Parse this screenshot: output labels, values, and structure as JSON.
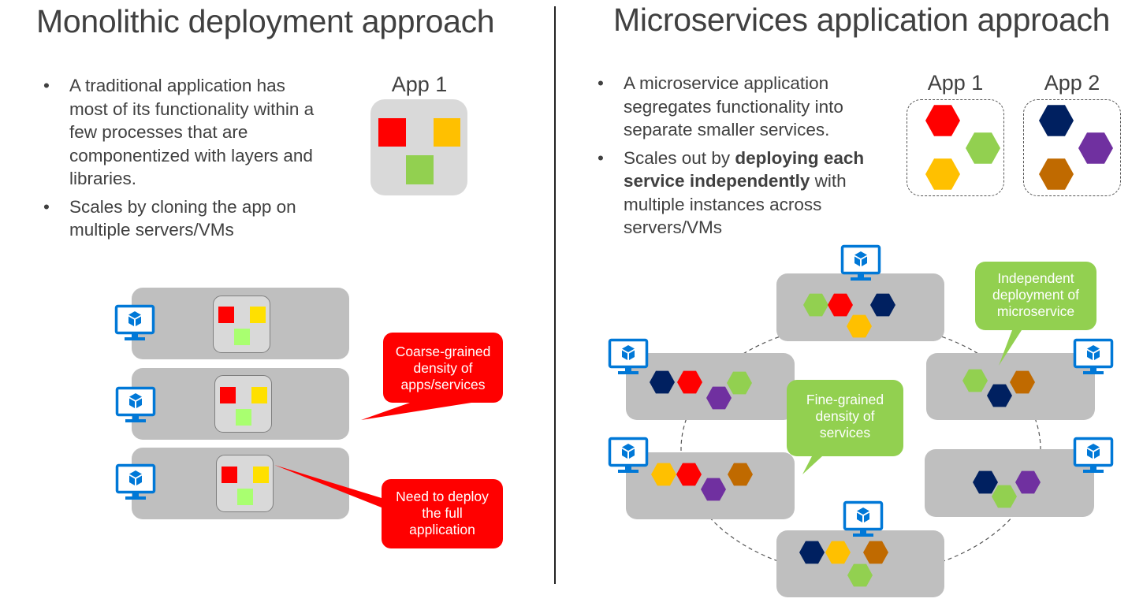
{
  "left": {
    "title": "Monolithic deployment approach",
    "bullets": [
      {
        "lines": [
          "A traditional application has",
          "most of its functionality within a",
          "few processes that are",
          "componentized with layers and",
          "libraries."
        ]
      },
      {
        "lines": [
          "Scales by cloning the app on",
          "multiple servers/VMs"
        ]
      }
    ],
    "app_label": "App 1",
    "callouts": [
      {
        "lines": [
          "Coarse-grained",
          "density of",
          "apps/services"
        ],
        "color": "#ff0000"
      },
      {
        "lines": [
          "Need to deploy",
          "the full",
          "application"
        ],
        "color": "#ff0000"
      }
    ]
  },
  "right": {
    "title": "Microservices application approach",
    "bullets": [
      {
        "lines": [
          "A microservice application",
          "segregates functionality into",
          "separate smaller services."
        ]
      },
      {
        "segments": [
          {
            "text": "Scales out by ",
            "bold": false
          },
          {
            "text": "deploying each",
            "bold": true
          },
          {
            "text": "service independently",
            "bold": true
          },
          {
            "text": " with",
            "bold": false
          },
          {
            "text": "multiple instances across",
            "bold": false
          },
          {
            "text": "servers/VMs",
            "bold": false
          }
        ]
      }
    ],
    "app_labels": [
      "App 1",
      "App 2"
    ],
    "callouts": [
      {
        "lines": [
          "Independent",
          "deployment of",
          "microservice"
        ],
        "color": "#92d050"
      },
      {
        "lines": [
          "Fine-grained",
          "density of",
          "services"
        ],
        "color": "#92d050"
      }
    ]
  },
  "icons": {
    "vm": "vm-monitor-icon",
    "service": "hexagon-service-icon",
    "component": "square-component-icon"
  },
  "colors": {
    "red": "#ff0000",
    "amber": "#ffc000",
    "green": "#92d050",
    "navy": "#002060",
    "purple": "#7030a0",
    "brown": "#c06a00",
    "azure": "#0078d7",
    "server_gray": "#bfbfbf",
    "app_gray": "#d9d9d9"
  }
}
